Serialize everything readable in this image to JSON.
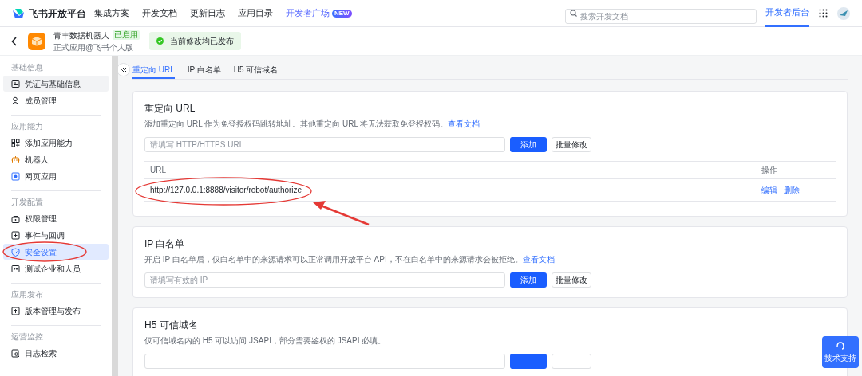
{
  "header": {
    "brand": "飞书开放平台",
    "nav": [
      {
        "label": "集成方案",
        "selected": false
      },
      {
        "label": "开发文档",
        "selected": false
      },
      {
        "label": "更新日志",
        "selected": false
      },
      {
        "label": "应用目录",
        "selected": false
      },
      {
        "label": "开发者广场",
        "selected": true,
        "badge": "NEW"
      }
    ],
    "search": {
      "placeholder": "搜索开发文档"
    },
    "console": {
      "label": "开发者后台",
      "selected": true
    }
  },
  "app_bar": {
    "name": "青丰数据机器人",
    "status": "已启用",
    "subtitle": "正式应用@飞书个人版",
    "notice": "当前修改均已发布"
  },
  "sidebar": {
    "sections": [
      {
        "title": "基础信息",
        "items": [
          {
            "label": "凭证与基础信息",
            "selected": false,
            "hovered": true
          },
          {
            "label": "成员管理",
            "selected": false,
            "hovered": false
          }
        ]
      },
      {
        "title": "应用能力",
        "items": [
          {
            "label": "添加应用能力",
            "selected": false,
            "hovered": false
          },
          {
            "label": "机器人",
            "selected": false,
            "hovered": false
          },
          {
            "label": "网页应用",
            "selected": false,
            "hovered": false
          }
        ]
      },
      {
        "title": "开发配置",
        "items": [
          {
            "label": "权限管理",
            "selected": false,
            "hovered": false
          },
          {
            "label": "事件与回调",
            "selected": false,
            "hovered": false
          },
          {
            "label": "安全设置",
            "selected": true,
            "hovered": false
          },
          {
            "label": "测试企业和人员",
            "selected": false,
            "hovered": false
          }
        ]
      },
      {
        "title": "应用发布",
        "items": [
          {
            "label": "版本管理与发布",
            "selected": false,
            "hovered": false
          }
        ]
      },
      {
        "title": "运营监控",
        "items": [
          {
            "label": "日志检索",
            "selected": false,
            "hovered": false
          }
        ]
      }
    ]
  },
  "tabs": [
    {
      "label": "重定向 URL",
      "selected": true
    },
    {
      "label": "IP 白名单",
      "selected": false
    },
    {
      "label": "H5 可信域名",
      "selected": false
    }
  ],
  "cards": [
    {
      "title": "重定向 URL",
      "description": "添加重定向 URL 作为免登授权码跳转地址。其他重定向 URL 将无法获取免登授权码。",
      "link": "查看文档",
      "placeholder": "请填写 HTTP/HTTPS URL",
      "add": "添加",
      "batch": "批量修改",
      "table": {
        "columns": [
          "URL",
          "操作"
        ],
        "rows": [
          {
            "url": "http://127.0.0.1:8888/visitor/robot/authorize",
            "actions": [
              "编辑",
              "删除"
            ]
          }
        ]
      }
    },
    {
      "title": "IP 白名单",
      "description": "开启 IP 白名单后，仅白名单中的来源请求可以正常调用开放平台 API，不在白名单中的来源请求会被拒绝。",
      "link": "查看文档",
      "placeholder": "请填写有效的 IP",
      "add": "添加",
      "batch": "批量修改"
    },
    {
      "title": "H5 可信域名",
      "description": "仅可信域名内的 H5 可以访问 JSAPI，部分需要鉴权的 JSAPI 必填。"
    }
  ],
  "support": {
    "label": "技术支持"
  }
}
